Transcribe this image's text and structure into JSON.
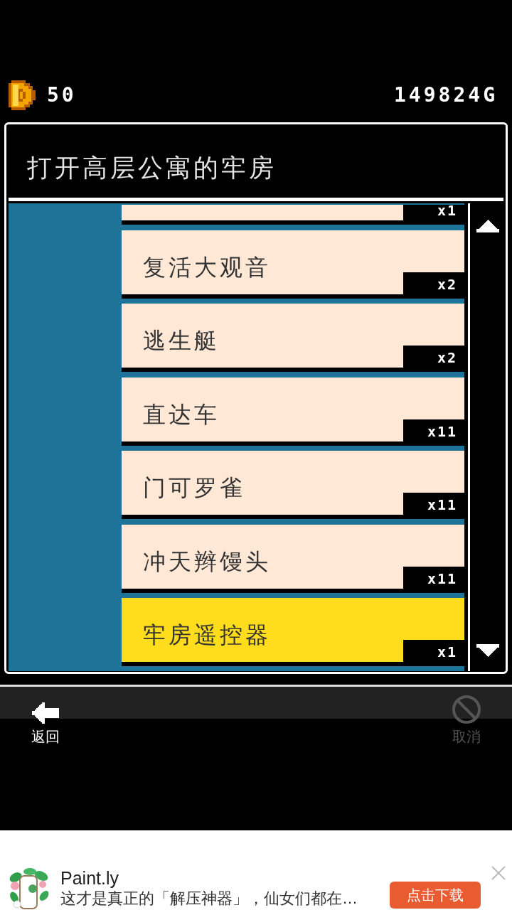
{
  "hud": {
    "gems": "50",
    "money": "149824G"
  },
  "dialog": {
    "title": "打开高层公寓的牢房",
    "items": [
      {
        "count": "x1",
        "selected": false
      },
      {
        "name": "复活大观音",
        "count": "x2",
        "selected": false
      },
      {
        "name": "逃生艇",
        "count": "x2",
        "selected": false
      },
      {
        "name": "直达车",
        "count": "x11",
        "selected": false
      },
      {
        "name": "门可罗雀",
        "count": "x11",
        "selected": false
      },
      {
        "name": "冲天辫馒头",
        "count": "x11",
        "selected": false
      },
      {
        "name": "牢房遥控器",
        "count": "x1",
        "selected": true
      }
    ]
  },
  "bottom_bar": {
    "buttons": [
      {
        "kind": "back",
        "label": "返回",
        "disabled": false
      },
      {
        "kind": "cancel",
        "label": "取消",
        "disabled": true
      }
    ]
  },
  "ad": {
    "app_name": "Paint.ly",
    "description": "这才是真正的「解压神器」，仙女们都在…",
    "button": "点击下载"
  }
}
